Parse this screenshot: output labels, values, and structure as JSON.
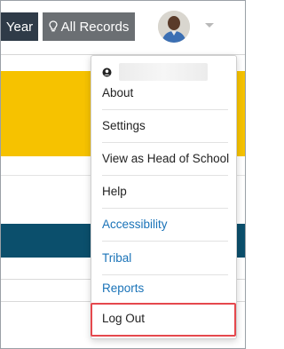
{
  "header": {
    "year_label": "Year",
    "records_label": "All Records",
    "records_icon": "lightbulb-icon",
    "avatar": "avatar",
    "dropdown_caret": "chevron-down-icon"
  },
  "menu": {
    "user_icon": "user-icon",
    "items": [
      {
        "label": "About",
        "style": "text"
      },
      {
        "label": "Settings",
        "style": "text"
      },
      {
        "label": "View as Head of School",
        "style": "text"
      },
      {
        "label": "Help",
        "style": "text"
      },
      {
        "label": "Accessibility",
        "style": "link"
      },
      {
        "label": "Tribal",
        "style": "link"
      },
      {
        "label": "Reports",
        "style": "link"
      },
      {
        "label": "Log Out",
        "style": "text"
      }
    ],
    "highlighted_item": "Log Out"
  },
  "colors": {
    "year_button": "#2f3b48",
    "records_button": "#6b6f73",
    "banner_yellow": "#f6c200",
    "bar_teal": "#0b4f6c",
    "link_blue": "#1a73b8",
    "highlight_red": "#e5484d"
  }
}
